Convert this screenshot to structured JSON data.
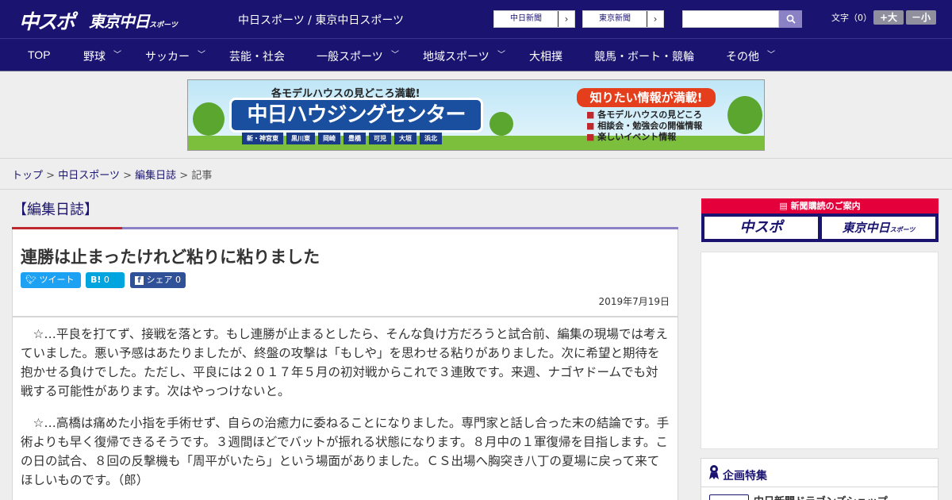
{
  "header": {
    "logo_chuspo": "中スポ",
    "logo_tokyo": "東京中日",
    "logo_tokyo_sub": "スポーツ",
    "site_names": "中日スポーツ / 東京中日スポーツ",
    "site_button_1": "中日新聞",
    "site_button_2": "東京新聞",
    "font_size_label": "文字（0）",
    "font_plus": "+大",
    "font_minus": "－小"
  },
  "nav": {
    "items": [
      {
        "label": "TOP"
      },
      {
        "label": "野球"
      },
      {
        "label": "サッカー"
      },
      {
        "label": "芸能・社会"
      },
      {
        "label": "一般スポーツ"
      },
      {
        "label": "地域スポーツ"
      },
      {
        "label": "大相撲"
      },
      {
        "label": "競馬・ボート・競輪"
      },
      {
        "label": "その他"
      }
    ]
  },
  "banner": {
    "top_text": "各モデルハウスの見どころ満載!",
    "main_text": "中日ハウジングセンター",
    "cities": [
      "新・神宮東",
      "黒川東",
      "岡崎",
      "豊橋",
      "可児",
      "大垣",
      "浜北"
    ],
    "right_title": "知りたい情報が満載!",
    "right_items": [
      "各モデルハウスの見どころ",
      "相談会・勉強会の開催情報",
      "楽しいイベント情報"
    ]
  },
  "breadcrumb": {
    "home": "トップ",
    "sep": ">",
    "section": "中日スポーツ",
    "category": "編集日誌",
    "current": "記事"
  },
  "article": {
    "section_title": "【編集日誌】",
    "headline": "連勝は止まったけれど粘りに粘りました",
    "share_tweet": "ツイート",
    "share_hatena_label": "B!",
    "share_hatena_count": "0",
    "share_fb_label": "シェア",
    "share_fb_count": "0",
    "date": "2019年7月19日",
    "paragraphs": [
      "☆…平良を打てず、接戦を落とす。もし連勝が止まるとしたら、そんな負け方だろうと試合前、編集の現場では考えていました。悪い予感はあたりましたが、終盤の攻撃は「もしや」を思わせる粘りがありました。次に希望と期待を抱かせる負けでした。ただし、平良には２０１７年５月の初対戦からこれで３連敗です。来週、ナゴヤドームでも対戦する可能性があります。次はやっつけないと。",
      "☆…高橋は痛めた小指を手術せず、自らの治癒力に委ねることになりました。専門家と話し合った末の結論です。手術よりも早く復帰できるそうです。３週間ほどでバットが振れる状態になります。８月中の１軍復帰を目指します。この日の試合、８回の反撃機も「周平がいたら」という場面がありました。ＣＳ出場へ胸突き八丁の夏場に戻って来てほしいものです。（郎）"
    ]
  },
  "sidebar": {
    "subscribe_head": "新聞購読のご案内",
    "subscribe_1": "中スポ",
    "subscribe_2": "東京中日",
    "subscribe_2_sub": "スポーツ",
    "feature_title": "企画特集",
    "feature_item": "中日新聞ドラゴンズショップ"
  }
}
